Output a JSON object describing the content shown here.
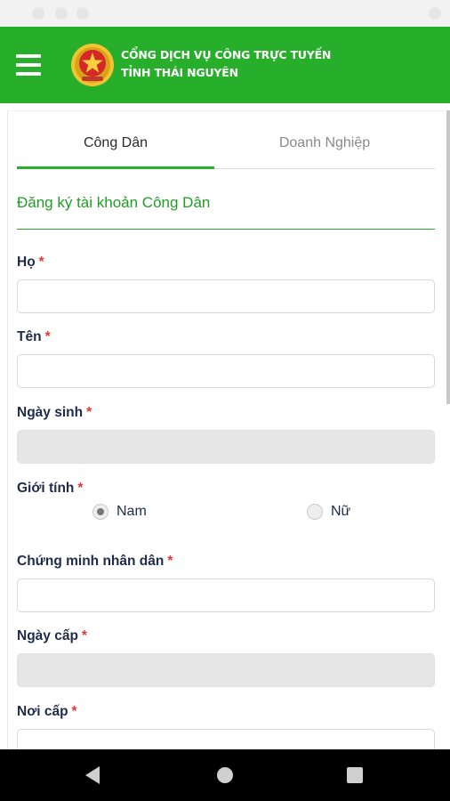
{
  "header": {
    "title_line1": "CỔNG DỊCH VỤ CÔNG TRỰC TUYẾN",
    "title_line2": "TỈNH THÁI NGUYÊN",
    "menu_icon": "hamburger-menu-icon",
    "logo_icon": "national-emblem-icon",
    "color": "#27ae2a"
  },
  "tabs": [
    {
      "label": "Công Dân",
      "active": true
    },
    {
      "label": "Doanh Nghiệp",
      "active": false
    }
  ],
  "form": {
    "title": "Đăng ký tài khoản Công Dân",
    "required_mark": "*",
    "fields": {
      "ho": {
        "label": "Họ",
        "value": ""
      },
      "ten": {
        "label": "Tên",
        "value": ""
      },
      "ngay_sinh": {
        "label": "Ngày sinh",
        "value": ""
      },
      "gioi_tinh": {
        "label": "Giới tính",
        "options": [
          "Nam",
          "Nữ"
        ],
        "selected": "Nam"
      },
      "cmnd": {
        "label": "Chứng minh nhân dân",
        "value": ""
      },
      "ngay_cap": {
        "label": "Ngày cấp",
        "value": ""
      },
      "noi_cap": {
        "label": "Nơi cấp",
        "value": ""
      }
    }
  },
  "nav": {
    "back_icon": "back-triangle-icon",
    "home_icon": "home-circle-icon",
    "recent_icon": "recent-apps-square-icon"
  },
  "colors": {
    "accent": "#27ae2a",
    "required": "#e53935",
    "label": "#1e2b4a"
  }
}
